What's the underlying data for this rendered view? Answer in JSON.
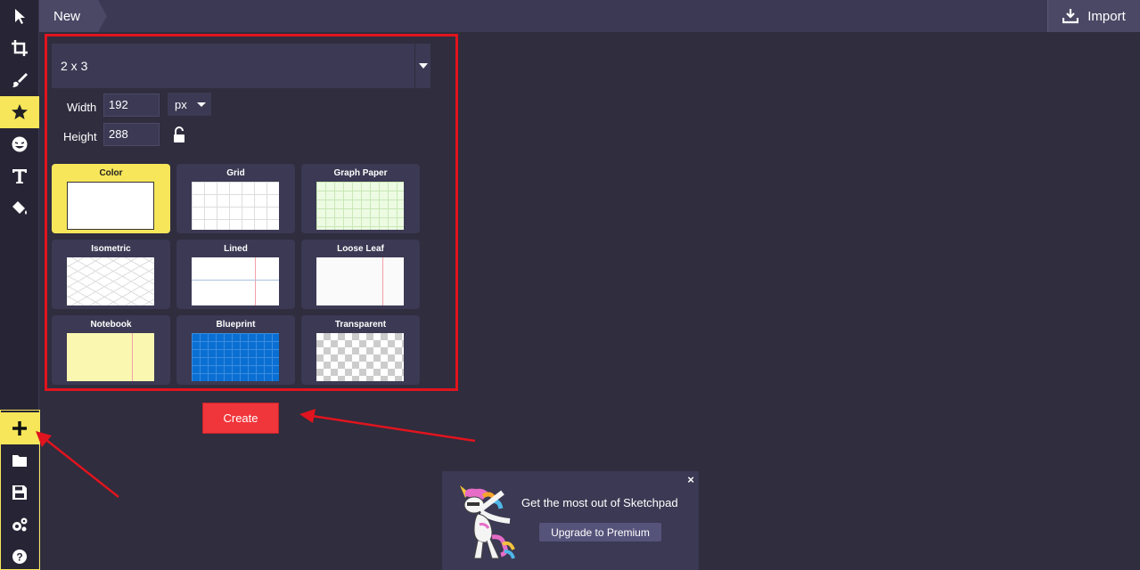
{
  "topbar": {
    "tab_label": "New",
    "import_label": "Import"
  },
  "toolbar": {
    "tools": [
      "select-icon",
      "crop-icon",
      "brush-icon",
      "star-icon",
      "emoji-icon",
      "text-icon",
      "fill-icon"
    ],
    "active_tool": "star-icon",
    "bottom_tools": [
      "plus-icon",
      "folder-icon",
      "save-icon",
      "settings-icon",
      "help-icon"
    ]
  },
  "dialog": {
    "preset_value": "2 x 3",
    "width_label": "Width",
    "width_value": "192",
    "height_label": "Height",
    "height_value": "288",
    "unit_value": "px",
    "backgrounds": [
      {
        "label": "Color"
      },
      {
        "label": "Grid"
      },
      {
        "label": "Graph Paper"
      },
      {
        "label": "Isometric"
      },
      {
        "label": "Lined"
      },
      {
        "label": "Loose Leaf"
      },
      {
        "label": "Notebook"
      },
      {
        "label": "Blueprint"
      },
      {
        "label": "Transparent"
      }
    ],
    "selected_background": "Color",
    "create_label": "Create"
  },
  "promo": {
    "title": "Get the most out of Sketchpad",
    "button_label": "Upgrade to Premium",
    "close_label": "×"
  },
  "colors": {
    "background": "#2f2d3e",
    "accent_yellow": "#f7e65a",
    "create_red": "#f0353b",
    "annotation_red": "#e0141e"
  }
}
